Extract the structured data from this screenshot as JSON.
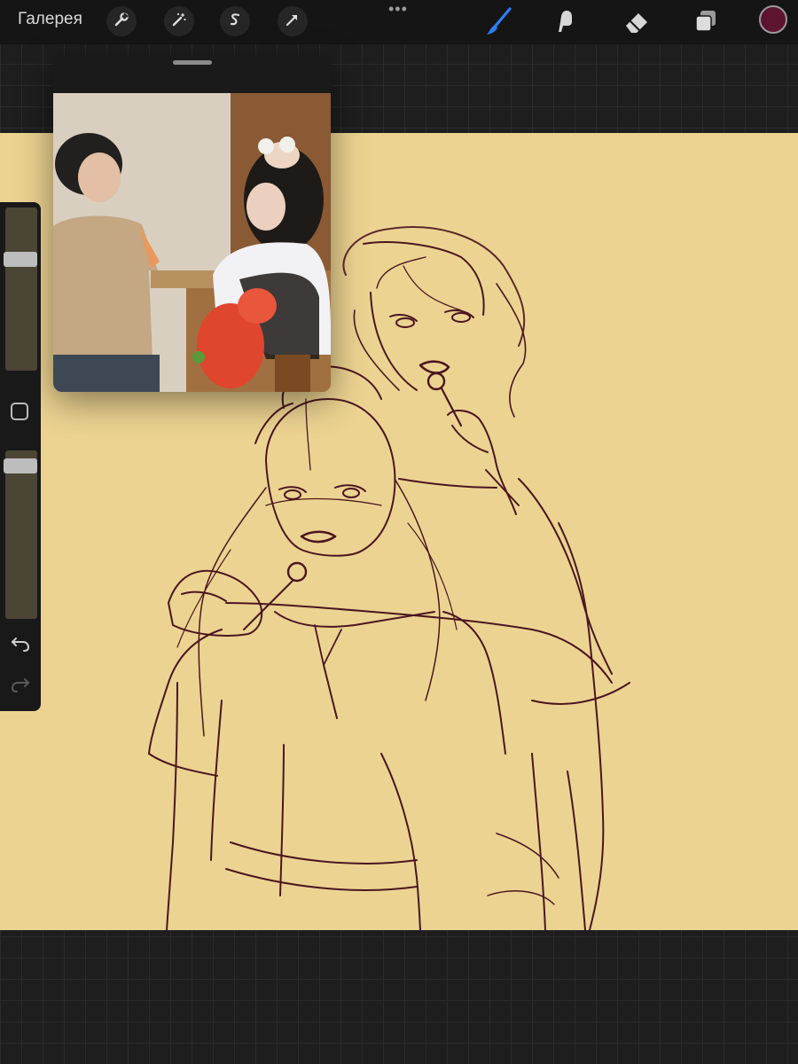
{
  "toolbar": {
    "gallery_label": "Галерея",
    "left_tools": [
      "wrench-icon",
      "magic-wand-icon",
      "selection-s-icon",
      "transform-arrow-icon"
    ],
    "more_dots": "•••",
    "right_tools": [
      "brush-icon",
      "smudge-icon",
      "eraser-icon",
      "layers-icon"
    ],
    "active_tool": "brush-icon",
    "active_tool_color": "#2f7cf6",
    "current_color": "#5c1430"
  },
  "canvas": {
    "background_color": "#ecd391",
    "stroke_color": "#4a1620"
  },
  "reference": {
    "window": "reference-window",
    "handle": "drag-handle"
  },
  "sidebar": {
    "brush_size_level": 0.3,
    "brush_opacity_level": 0.05,
    "modifier_icon": "square-modifier-icon",
    "undo_icon": "undo-icon",
    "redo_icon": "redo-icon"
  }
}
